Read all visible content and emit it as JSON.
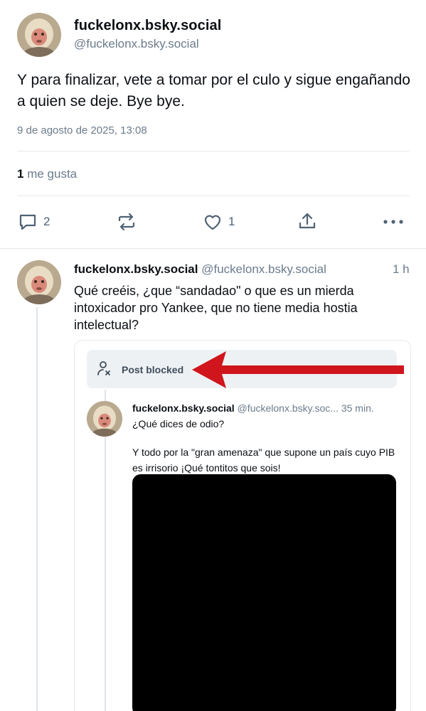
{
  "main_post": {
    "display_name": "fuckelonx.bsky.social",
    "handle": "@fuckelonx.bsky.social",
    "text": "Y para finalizar, vete a tomar por el culo y sigue engañando a quien se deje. Bye bye.",
    "date": "9 de agosto de 2025, 13:08",
    "likes_count": "1",
    "likes_label": "me gusta",
    "actions": {
      "reply_icon": "reply-icon",
      "reply_count": "2",
      "repost_icon": "repost-icon",
      "like_icon": "heart-icon",
      "like_count": "1",
      "share_icon": "share-icon",
      "more_icon": "more-icon"
    }
  },
  "reply": {
    "display_name": "fuckelonx.bsky.social",
    "handle": "@fuckelonx.bsky.social",
    "time": "1 h",
    "text": "Qué creéis, ¿que “sandadao\" o que es un mierda intoxicador pro Yankee, que no tiene media hostia intelectual?"
  },
  "embed": {
    "blocked_icon": "person-blocked-icon",
    "blocked_label": "Post blocked",
    "quoted": {
      "display_name": "fuckelonx.bsky.social",
      "handle": "@fuckelonx.bsky.soc...",
      "time": "35 min.",
      "text1": "¿Qué dices de odio?",
      "text2": "Y todo por la \"gran amenaza\" que supone un país cuyo PIB es irrisorio ¡Qué tontitos que sois!"
    }
  },
  "colors": {
    "arrow": "#d0151c",
    "muted_text": "#6b7b8c",
    "action_icon": "#4f6275"
  }
}
